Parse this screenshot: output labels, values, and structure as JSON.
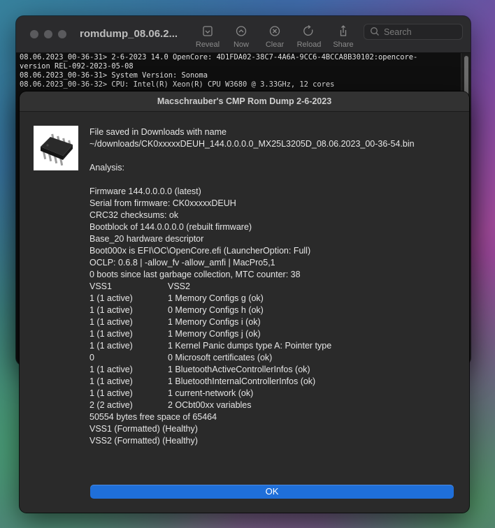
{
  "terminal": {
    "title": "romdump_08.06.2...",
    "toolbar": [
      {
        "label": "Reveal",
        "icon": "reveal-icon"
      },
      {
        "label": "Now",
        "icon": "now-icon"
      },
      {
        "label": "Clear",
        "icon": "clear-icon"
      },
      {
        "label": "Reload",
        "icon": "reload-icon"
      },
      {
        "label": "Share",
        "icon": "share-icon"
      }
    ],
    "search_placeholder": "Search",
    "lines": [
      "08.06.2023_00-36-31> 2-6-2023 14.0 OpenCore: 4D1FDA02-38C7-4A6A-9CC6-4BCCA8B30102:opencore-",
      "version REL-092-2023-05-08",
      "08.06.2023_00-36-31> System Version: Sonoma",
      "08.06.2023_00-36-32> CPU: Intel(R) Xeon(R) CPU W3680 @ 3.33GHz, 12 cores"
    ]
  },
  "dialog": {
    "title": "Macschrauber's CMP Rom Dump 2-6-2023",
    "icon": "chip-icon",
    "saved_line1": "File saved in Downloads with name",
    "saved_line2": "~/downloads/CK0xxxxxDEUH_144.0.0.0.0_MX25L3205D_08.06.2023_00-36-54.bin",
    "analysis_label": "Analysis:",
    "info_lines": [
      "Firmware 144.0.0.0.0 (latest)",
      "Serial from firmware: CK0xxxxxDEUH",
      "CRC32 checksums: ok",
      "Bootblock of 144.0.0.0.0 (rebuilt firmware)",
      "Base_20 hardware descriptor",
      "Boot000x is EFI\\OC\\OpenCore.efi (LauncherOption: Full)",
      "OCLP: 0.6.8 | -allow_fv -allow_amfi | MacPro5,1",
      "0 boots since last garbage collection, MTC counter: 38"
    ],
    "vss_table": [
      {
        "vss1": "VSS1",
        "vss2": "VSS2"
      },
      {
        "vss1": "1 (1 active)",
        "vss2": "1 Memory Configs g (ok)"
      },
      {
        "vss1": "1 (1 active)",
        "vss2": "0 Memory Configs h (ok)"
      },
      {
        "vss1": "1 (1 active)",
        "vss2": "1 Memory Configs i (ok)"
      },
      {
        "vss1": "1 (1 active)",
        "vss2": "1 Memory Configs j (ok)"
      },
      {
        "vss1": "1 (1 active)",
        "vss2": "1 Kernel Panic dumps type A: Pointer type"
      },
      {
        "vss1": "0",
        "vss2": "0 Microsoft certificates (ok)"
      },
      {
        "vss1": "1 (1 active)",
        "vss2": "1 BluetoothActiveControllerInfos (ok)"
      },
      {
        "vss1": "1 (1 active)",
        "vss2": "1 BluetoothInternalControllerInfos (ok)"
      },
      {
        "vss1": "1 (1 active)",
        "vss2": "1 current-network (ok)"
      },
      {
        "vss1": "2 (2 active)",
        "vss2": "2 OCbt00xx variables"
      }
    ],
    "footer_lines": [
      "50554 bytes free space of 65464",
      "VSS1 (Formatted) (Healthy)",
      "VSS2 (Formatted) (Healthy)"
    ],
    "ok_label": "OK"
  }
}
